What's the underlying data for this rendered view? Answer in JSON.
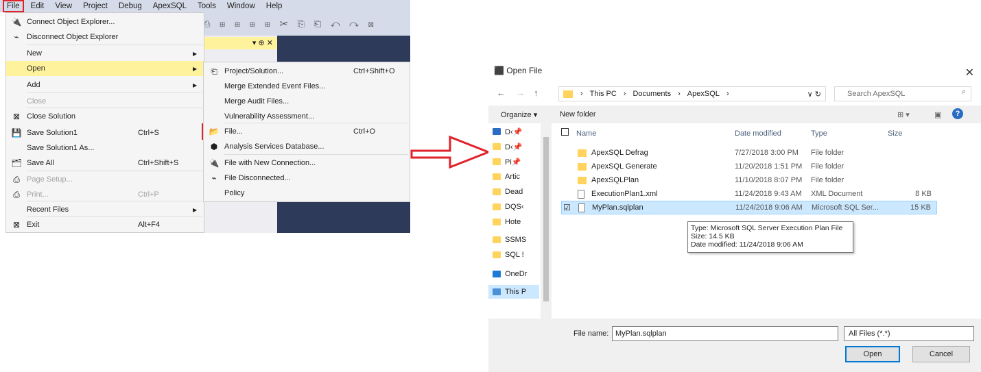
{
  "ssms": {
    "menubar": [
      "File",
      "Edit",
      "View",
      "Project",
      "Debug",
      "ApexSQL",
      "Tools",
      "Window",
      "Help"
    ],
    "toolbar_icons": "⎙ ⊞ ⊞ ⊞ ⊞ ✂ ⎘ ⎗ ↶ ↷ ⊠",
    "tab_controls": "▾ ⊕ ✕",
    "file_menu": [
      {
        "label": "Connect Object Explorer...",
        "shortcut": "",
        "icon": "plug-icon",
        "glyph": "🔌",
        "arrow": false,
        "disabled": false,
        "highlight": false
      },
      {
        "label": "Disconnect Object Explorer",
        "shortcut": "",
        "icon": "unplug-icon",
        "glyph": "⌁",
        "arrow": false,
        "disabled": false,
        "highlight": false
      },
      {
        "label": "New",
        "shortcut": "",
        "icon": "",
        "glyph": "",
        "arrow": true,
        "disabled": false,
        "highlight": false
      },
      {
        "label": "Open",
        "shortcut": "",
        "icon": "",
        "glyph": "",
        "arrow": true,
        "disabled": false,
        "highlight": true
      },
      {
        "label": "Add",
        "shortcut": "",
        "icon": "",
        "glyph": "",
        "arrow": true,
        "disabled": false,
        "highlight": false
      },
      {
        "label": "Close",
        "shortcut": "",
        "icon": "",
        "glyph": "",
        "arrow": false,
        "disabled": true,
        "highlight": false
      },
      {
        "label": "Close Solution",
        "shortcut": "",
        "icon": "close-solution-icon",
        "glyph": "⊠",
        "arrow": false,
        "disabled": false,
        "highlight": false
      },
      {
        "label": "Save Solution1",
        "shortcut": "Ctrl+S",
        "icon": "save-icon",
        "glyph": "💾",
        "arrow": false,
        "disabled": false,
        "highlight": false
      },
      {
        "label": "Save Solution1 As...",
        "shortcut": "",
        "icon": "",
        "glyph": "",
        "arrow": false,
        "disabled": false,
        "highlight": false
      },
      {
        "label": "Save All",
        "shortcut": "Ctrl+Shift+S",
        "icon": "save-all-icon",
        "glyph": "🗂",
        "arrow": false,
        "disabled": false,
        "highlight": false
      },
      {
        "label": "Page Setup...",
        "shortcut": "",
        "icon": "page-setup-icon",
        "glyph": "⎙",
        "arrow": false,
        "disabled": true,
        "highlight": false
      },
      {
        "label": "Print...",
        "shortcut": "Ctrl+P",
        "icon": "print-icon",
        "glyph": "⎙",
        "arrow": false,
        "disabled": true,
        "highlight": false
      },
      {
        "label": "Recent Files",
        "shortcut": "",
        "icon": "",
        "glyph": "",
        "arrow": true,
        "disabled": false,
        "highlight": false
      },
      {
        "label": "Exit",
        "shortcut": "Alt+F4",
        "icon": "exit-icon",
        "glyph": "⊠",
        "arrow": false,
        "disabled": false,
        "highlight": false
      }
    ],
    "open_submenu": [
      {
        "label": "Project/Solution...",
        "shortcut": "Ctrl+Shift+O",
        "icon": "project-icon",
        "glyph": "⎗"
      },
      {
        "label": "Merge Extended Event Files...",
        "shortcut": "",
        "icon": "",
        "glyph": ""
      },
      {
        "label": "Merge Audit Files...",
        "shortcut": "",
        "icon": "",
        "glyph": ""
      },
      {
        "label": "Vulnerability Assessment...",
        "shortcut": "",
        "icon": "",
        "glyph": ""
      },
      {
        "label": "File...",
        "shortcut": "Ctrl+O",
        "icon": "open-file-icon",
        "glyph": "📂"
      },
      {
        "label": "Analysis Services Database...",
        "shortcut": "",
        "icon": "database-cube-icon",
        "glyph": "⬢"
      },
      {
        "label": "File with New Connection...",
        "shortcut": "",
        "icon": "plug-icon",
        "glyph": "🔌"
      },
      {
        "label": "File Disconnected...",
        "shortcut": "",
        "icon": "unplug-icon",
        "glyph": "⌁"
      },
      {
        "label": "Policy",
        "shortcut": "",
        "icon": "",
        "glyph": ""
      }
    ]
  },
  "dialog": {
    "title": "Open File",
    "breadcrumb": [
      "This PC",
      "Documents",
      "ApexSQL"
    ],
    "search_placeholder": "Search ApexSQL",
    "organize": "Organize ▾",
    "new_folder": "New folder",
    "nav_items": [
      "D‹📌",
      "D‹📌",
      "Pi📌",
      "Artic",
      "Dead",
      "DQS‹",
      "Hote",
      "SSMS",
      "SQL !",
      "OneDr",
      "This P"
    ],
    "columns": {
      "name": "Name",
      "date": "Date modified",
      "type": "Type",
      "size": "Size"
    },
    "files": [
      {
        "name": "ApexSQL Defrag",
        "date": "7/27/2018 3:00 PM",
        "type": "File folder",
        "size": "",
        "kind": "folder"
      },
      {
        "name": "ApexSQL Generate",
        "date": "11/20/2018 1:51 PM",
        "type": "File folder",
        "size": "",
        "kind": "folder"
      },
      {
        "name": "ApexSQLPlan",
        "date": "11/10/2018 8:07 PM",
        "type": "File folder",
        "size": "",
        "kind": "folder"
      },
      {
        "name": "ExecutionPlan1.xml",
        "date": "11/24/2018 9:43 AM",
        "type": "XML Document",
        "size": "8 KB",
        "kind": "file"
      },
      {
        "name": "MyPlan.sqlplan",
        "date": "11/24/2018 9:06 AM",
        "type": "Microsoft SQL Ser...",
        "size": "15 KB",
        "kind": "plan"
      }
    ],
    "tooltip": {
      "line1": "Type: Microsoft SQL Server Execution Plan File",
      "line2": "Size: 14.5 KB",
      "line3": "Date modified: 11/24/2018 9:06 AM"
    },
    "filename_label": "File name:",
    "filename_value": "MyPlan.sqlplan",
    "filter_value": "All Files (*.*)",
    "open_label": "Open",
    "cancel_label": "Cancel"
  },
  "colors": {
    "highlight": "#fff29d",
    "callout": "#e0222a",
    "selection": "#cce8ff",
    "vs_chrome": "#d6dbe9"
  }
}
